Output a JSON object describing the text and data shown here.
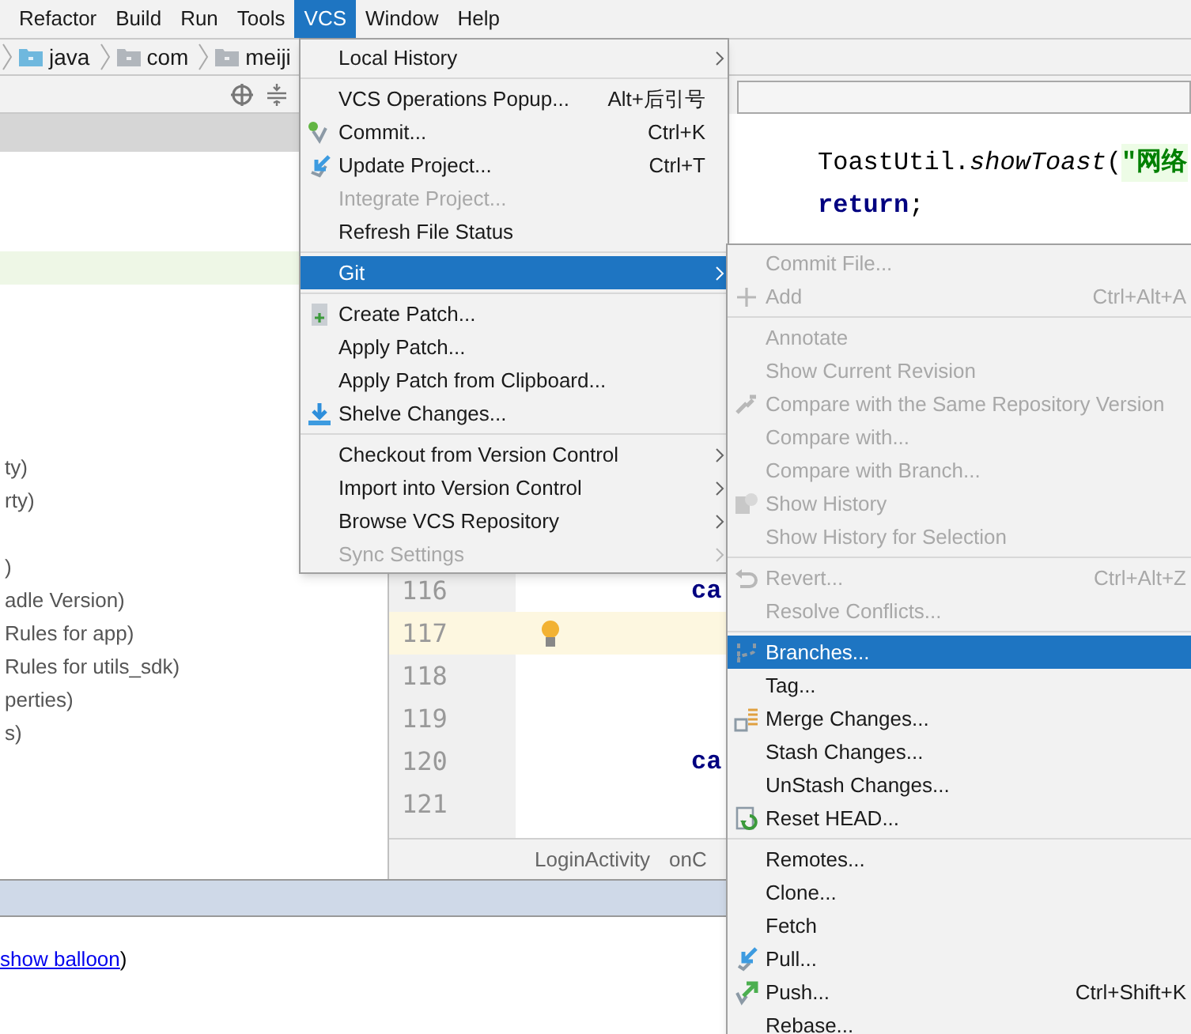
{
  "menubar": [
    {
      "label": "Refactor",
      "selected": false
    },
    {
      "label": "Build",
      "selected": false
    },
    {
      "label": "Run",
      "selected": false
    },
    {
      "label": "Tools",
      "selected": false
    },
    {
      "label": "VCS",
      "selected": true
    },
    {
      "label": "Window",
      "selected": false
    },
    {
      "label": "Help",
      "selected": false
    }
  ],
  "breadcrumb": [
    {
      "label": "java",
      "color": "#6fb8de"
    },
    {
      "label": "com",
      "color": "#b1b6bc"
    },
    {
      "label": "meiji",
      "color": "#b1b6bc"
    }
  ],
  "project_tree": {
    "rows": [
      {
        "selected": false
      },
      {
        "selected": false
      },
      {
        "selected": false
      },
      {
        "selected": true
      },
      {
        "selected": false
      },
      {
        "selected": false
      },
      {
        "selected": false
      },
      {
        "selected": false
      },
      {
        "selected": false
      },
      {
        "text": "ty)",
        "selected": false
      },
      {
        "text": "rty)",
        "selected": false
      },
      {
        "selected": false
      },
      {
        "text": ")",
        "selected": false
      },
      {
        "text": "adle Version)",
        "selected": false
      },
      {
        "text": "Rules for app)",
        "selected": false
      },
      {
        "text": "Rules for utils_sdk)",
        "selected": false
      },
      {
        "text": "perties)",
        "selected": false
      },
      {
        "text": "s)",
        "selected": false
      }
    ]
  },
  "editor": {
    "code_lines": [
      {
        "code": "ToastUtil.*showToast*(",
        "string": "\"网络"
      },
      {
        "code": "**return**;"
      }
    ],
    "rows": [
      {
        "number": "116",
        "code": "ca",
        "current": false,
        "bulb": false
      },
      {
        "number": "117",
        "current": true,
        "bulb": true
      },
      {
        "number": "118",
        "current": false,
        "bulb": false
      },
      {
        "number": "119",
        "current": false,
        "bulb": false
      },
      {
        "number": "120",
        "code": "ca",
        "current": false,
        "bulb": false
      },
      {
        "number": "121",
        "current": false,
        "bulb": false
      }
    ],
    "breadcrumb": [
      "LoginActivity",
      "onC"
    ]
  },
  "bottom_panel": {
    "link": "show balloon",
    "after": ")"
  },
  "vcs_menu": {
    "items": [
      {
        "kind": "item",
        "label": "Local History",
        "submenu": true,
        "disabled": false,
        "selected": false
      },
      {
        "kind": "separator"
      },
      {
        "kind": "item",
        "label": "VCS Operations Popup...",
        "shortcut": "Alt+后引号",
        "submenu": false,
        "disabled": false,
        "selected": false
      },
      {
        "kind": "item",
        "label": "Commit...",
        "shortcut": "Ctrl+K",
        "submenu": false,
        "disabled": false,
        "selected": false
      },
      {
        "kind": "item",
        "label": "Update Project...",
        "shortcut": "Ctrl+T",
        "submenu": false,
        "disabled": false,
        "selected": false
      },
      {
        "kind": "item",
        "label": "Integrate Project...",
        "submenu": false,
        "disabled": true,
        "selected": false
      },
      {
        "kind": "item",
        "label": "Refresh File Status",
        "submenu": false,
        "disabled": false,
        "selected": false
      },
      {
        "kind": "separator"
      },
      {
        "kind": "item",
        "label": "Git",
        "submenu": true,
        "disabled": false,
        "selected": true
      },
      {
        "kind": "separator"
      },
      {
        "kind": "item",
        "label": "Create Patch...",
        "submenu": false,
        "disabled": false,
        "selected": false
      },
      {
        "kind": "item",
        "label": "Apply Patch...",
        "submenu": false,
        "disabled": false,
        "selected": false
      },
      {
        "kind": "item",
        "label": "Apply Patch from Clipboard...",
        "submenu": false,
        "disabled": false,
        "selected": false
      },
      {
        "kind": "item",
        "label": "Shelve Changes...",
        "submenu": false,
        "disabled": false,
        "selected": false
      },
      {
        "kind": "separator"
      },
      {
        "kind": "item",
        "label": "Checkout from Version Control",
        "submenu": true,
        "disabled": false,
        "selected": false
      },
      {
        "kind": "item",
        "label": "Import into Version Control",
        "submenu": true,
        "disabled": false,
        "selected": false
      },
      {
        "kind": "item",
        "label": "Browse VCS Repository",
        "submenu": true,
        "disabled": false,
        "selected": false
      },
      {
        "kind": "item",
        "label": "Sync Settings",
        "submenu": true,
        "disabled": true,
        "selected": false
      }
    ]
  },
  "git_menu": {
    "items": [
      {
        "kind": "item",
        "label": "Commit File...",
        "disabled": true,
        "selected": false
      },
      {
        "kind": "item",
        "label": "Add",
        "shortcut": "Ctrl+Alt+A",
        "disabled": true,
        "selected": false
      },
      {
        "kind": "separator"
      },
      {
        "kind": "item",
        "label": "Annotate",
        "disabled": true,
        "selected": false
      },
      {
        "kind": "item",
        "label": "Show Current Revision",
        "disabled": true,
        "selected": false
      },
      {
        "kind": "item",
        "label": "Compare with the Same Repository Version",
        "disabled": true,
        "selected": false
      },
      {
        "kind": "item",
        "label": "Compare with...",
        "disabled": true,
        "selected": false
      },
      {
        "kind": "item",
        "label": "Compare with Branch...",
        "disabled": true,
        "selected": false
      },
      {
        "kind": "item",
        "label": "Show History",
        "disabled": true,
        "selected": false
      },
      {
        "kind": "item",
        "label": "Show History for Selection",
        "disabled": true,
        "selected": false
      },
      {
        "kind": "separator"
      },
      {
        "kind": "item",
        "label": "Revert...",
        "shortcut": "Ctrl+Alt+Z",
        "disabled": true,
        "selected": false
      },
      {
        "kind": "item",
        "label": "Resolve Conflicts...",
        "disabled": true,
        "selected": false
      },
      {
        "kind": "separator"
      },
      {
        "kind": "item",
        "label": "Branches...",
        "disabled": false,
        "selected": true
      },
      {
        "kind": "item",
        "label": "Tag...",
        "disabled": false,
        "selected": false
      },
      {
        "kind": "item",
        "label": "Merge Changes...",
        "disabled": false,
        "selected": false
      },
      {
        "kind": "item",
        "label": "Stash Changes...",
        "disabled": false,
        "selected": false
      },
      {
        "kind": "item",
        "label": "UnStash Changes...",
        "disabled": false,
        "selected": false
      },
      {
        "kind": "item",
        "label": "Reset HEAD...",
        "disabled": false,
        "selected": false
      },
      {
        "kind": "separator"
      },
      {
        "kind": "item",
        "label": "Remotes...",
        "disabled": false,
        "selected": false
      },
      {
        "kind": "item",
        "label": "Clone...",
        "disabled": false,
        "selected": false
      },
      {
        "kind": "item",
        "label": "Fetch",
        "disabled": false,
        "selected": false
      },
      {
        "kind": "item",
        "label": "Pull...",
        "disabled": false,
        "selected": false
      },
      {
        "kind": "item",
        "label": "Push...",
        "shortcut": "Ctrl+Shift+K",
        "disabled": false,
        "selected": false
      },
      {
        "kind": "item",
        "label": "Rebase...",
        "disabled": false,
        "selected": false
      }
    ]
  }
}
